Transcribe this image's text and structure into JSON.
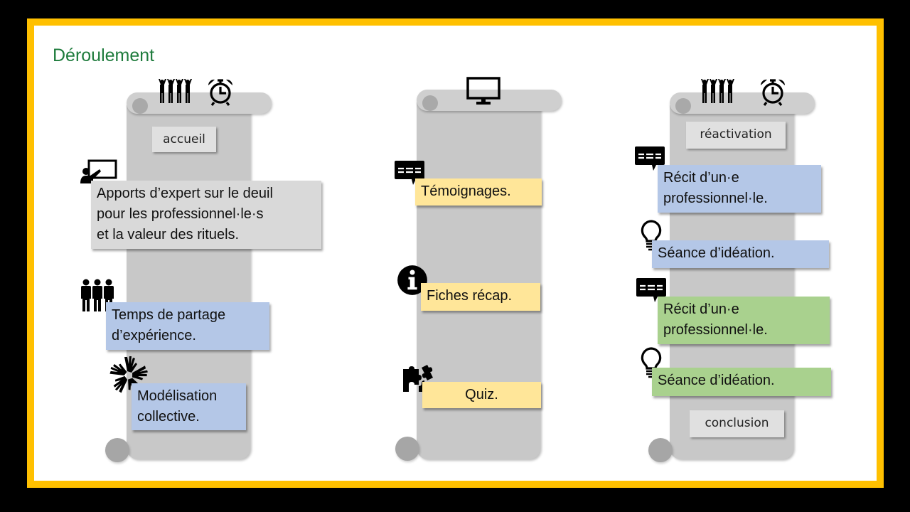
{
  "title": "Déroulement",
  "colors": {
    "frame": "#FFC000",
    "title": "#1E7B3C",
    "box_gray": "#D9D9D9",
    "box_blue": "#B4C7E7",
    "box_yellow": "#FFE699",
    "box_green": "#A9D18E"
  },
  "columns": [
    {
      "header_icons": [
        "group-cheering-icon",
        "alarm-clock-icon"
      ],
      "items": [
        {
          "type": "label",
          "text": "accueil"
        },
        {
          "type": "box",
          "color": "gray",
          "icon": "teacher-board-icon",
          "lines": [
            "Apports d’expert sur le deuil",
            "pour les professionnel·le·s",
            "et la valeur des rituels."
          ]
        },
        {
          "type": "box",
          "color": "blue",
          "icon": "people-group-icon",
          "lines": [
            "Temps de partage",
            "d’expérience."
          ]
        },
        {
          "type": "box",
          "color": "blue",
          "icon": "hands-collaboration-icon",
          "lines": [
            "Modélisation",
            "collective."
          ]
        }
      ]
    },
    {
      "header_icons": [
        "monitor-icon"
      ],
      "items": [
        {
          "type": "box",
          "color": "yellow",
          "icon": "speech-bubble-icon",
          "lines": [
            "Témoignages."
          ]
        },
        {
          "type": "box",
          "color": "yellow",
          "icon": "info-icon",
          "lines": [
            "Fiches récap."
          ]
        },
        {
          "type": "box",
          "color": "yellow",
          "icon": "puzzle-icon",
          "lines": [
            "Quiz."
          ]
        }
      ]
    },
    {
      "header_icons": [
        "group-cheering-icon",
        "alarm-clock-icon"
      ],
      "items": [
        {
          "type": "label",
          "text": "réactivation"
        },
        {
          "type": "box",
          "color": "blue",
          "icon": "speech-bubble-icon",
          "lines": [
            "Récit d’un·e",
            "professionnel·le."
          ]
        },
        {
          "type": "box",
          "color": "blue",
          "icon": "lightbulb-icon",
          "lines": [
            "Séance d’idéation."
          ]
        },
        {
          "type": "box",
          "color": "green",
          "icon": "speech-bubble-icon",
          "lines": [
            "Récit d’un·e",
            "professionnel·le."
          ]
        },
        {
          "type": "box",
          "color": "green",
          "icon": "lightbulb-icon",
          "lines": [
            "Séance d’idéation."
          ]
        },
        {
          "type": "label",
          "text": "conclusion"
        }
      ]
    }
  ]
}
